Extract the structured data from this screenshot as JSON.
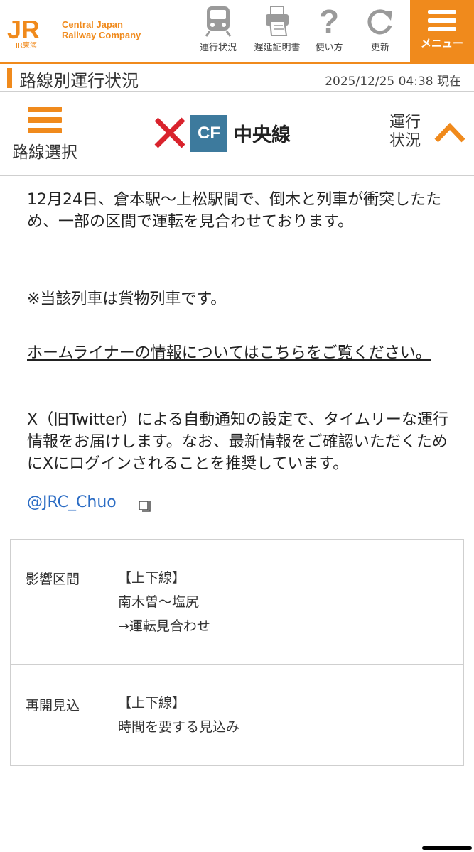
{
  "header": {
    "logo_text": "JR",
    "logo_sub": "JR東海",
    "company_line1": "Central Japan",
    "company_line2": "Railway Company",
    "brand_color": "#f08a1c",
    "nav": [
      {
        "label": "運行状況",
        "icon": "train-icon"
      },
      {
        "label": "遅延証明書",
        "icon": "certificate-printer-icon"
      },
      {
        "label": "使い方",
        "icon": "question-icon"
      },
      {
        "label": "更新",
        "icon": "refresh-icon"
      }
    ],
    "menu_label": "メニュー"
  },
  "title_bar": {
    "title": "路線別運行状況",
    "timestamp": "2025/12/25 04:38 現在"
  },
  "line_bar": {
    "route_select_label": "路線選択",
    "status_icon": "stop-x-icon",
    "line_code": "CF",
    "line_code_color": "#3d7a9d",
    "line_name": "中央線",
    "op_status_line1": "運行",
    "op_status_line2": "状況"
  },
  "content": {
    "message": "12月24日、倉本駅〜上松駅間で、倒木と列車が衝突したため、一部の区間で運転を見合わせております。",
    "note": "※当該列車は貨物列車です。",
    "home_liner_link": "ホームライナーの情報についてはこちらをご覧ください。",
    "x_notice": "X（旧Twitter）による自動通知の設定で、タイムリーな運行情報をお届けします。なお、最新情報をご確認いただくためにXにログインされることを推奨しています。",
    "x_handle": "@JRC_Chuo"
  },
  "info_table": {
    "rows": [
      {
        "label": "影響区間",
        "direction": "【上下線】",
        "section": "南木曽〜塩尻",
        "status": "→運転見合わせ"
      },
      {
        "label": "再開見込",
        "direction": "【上下線】",
        "section": "時間を要する見込み"
      }
    ]
  }
}
